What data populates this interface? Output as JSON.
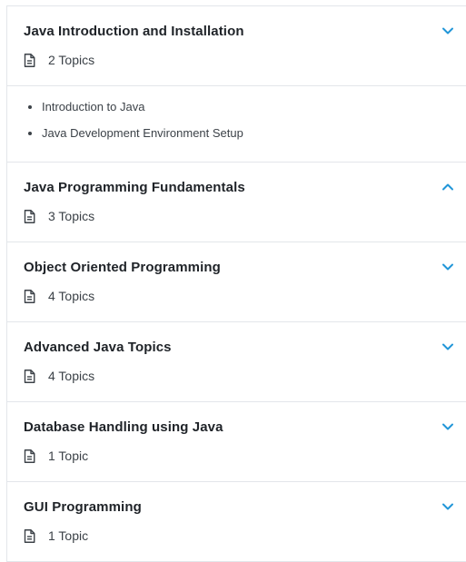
{
  "accent_color": "#2196d8",
  "sections": [
    {
      "title": "Java Introduction and Installation",
      "topic_count": "2 Topics",
      "expanded": true,
      "chevron": "chevron-down-icon",
      "topics": [
        "Introduction to Java",
        "Java Development Environment Setup"
      ]
    },
    {
      "title": "Java Programming Fundamentals",
      "topic_count": "3 Topics",
      "expanded": false,
      "chevron": "chevron-up-icon"
    },
    {
      "title": "Object Oriented Programming",
      "topic_count": "4 Topics",
      "expanded": false,
      "chevron": "chevron-down-icon"
    },
    {
      "title": "Advanced Java Topics",
      "topic_count": "4 Topics",
      "expanded": false,
      "chevron": "chevron-down-icon"
    },
    {
      "title": "Database Handling using Java",
      "topic_count": "1 Topic",
      "expanded": false,
      "chevron": "chevron-down-icon"
    },
    {
      "title": "GUI Programming",
      "topic_count": "1 Topic",
      "expanded": false,
      "chevron": "chevron-down-icon"
    }
  ]
}
